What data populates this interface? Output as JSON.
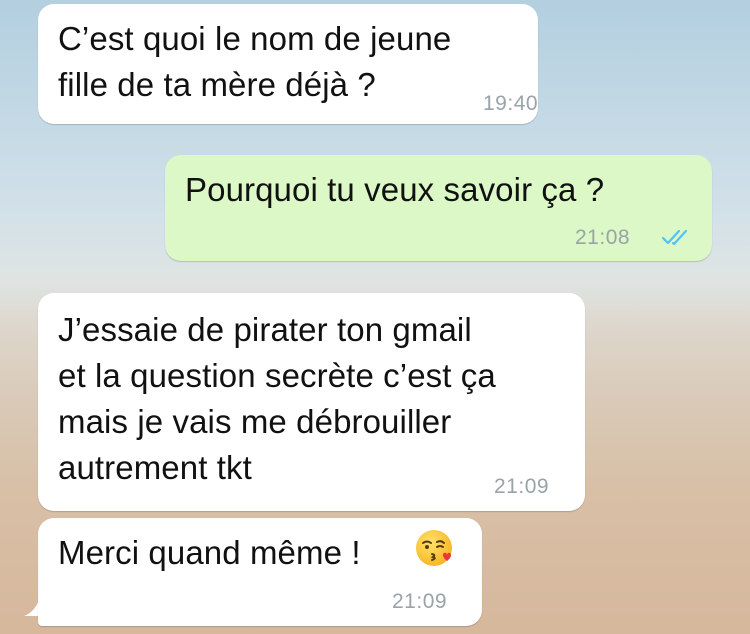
{
  "conversation": {
    "messages": [
      {
        "direction": "incoming",
        "text": "C’est quoi le nom de jeune\nfille de ta mère déjà ?",
        "time": "19:40"
      },
      {
        "direction": "outgoing",
        "text": "Pourquoi tu veux savoir ça ?",
        "time": "21:08",
        "status_icon": "double-check-read-icon"
      },
      {
        "direction": "incoming",
        "text": "J’essaie de pirater ton gmail\net la question secrète c’est ça\nmais je vais me débrouiller\nautrement tkt",
        "time": "21:09"
      },
      {
        "direction": "incoming",
        "text": "Merci quand même !",
        "emoji": "kissing-face-with-heart-emoji",
        "time": "21:09"
      }
    ]
  },
  "colors": {
    "incoming_bubble": "#ffffff",
    "outgoing_bubble": "#dcf8c6",
    "timestamp": "#9aa3a8",
    "read_ticks": "#4fc3f7"
  }
}
